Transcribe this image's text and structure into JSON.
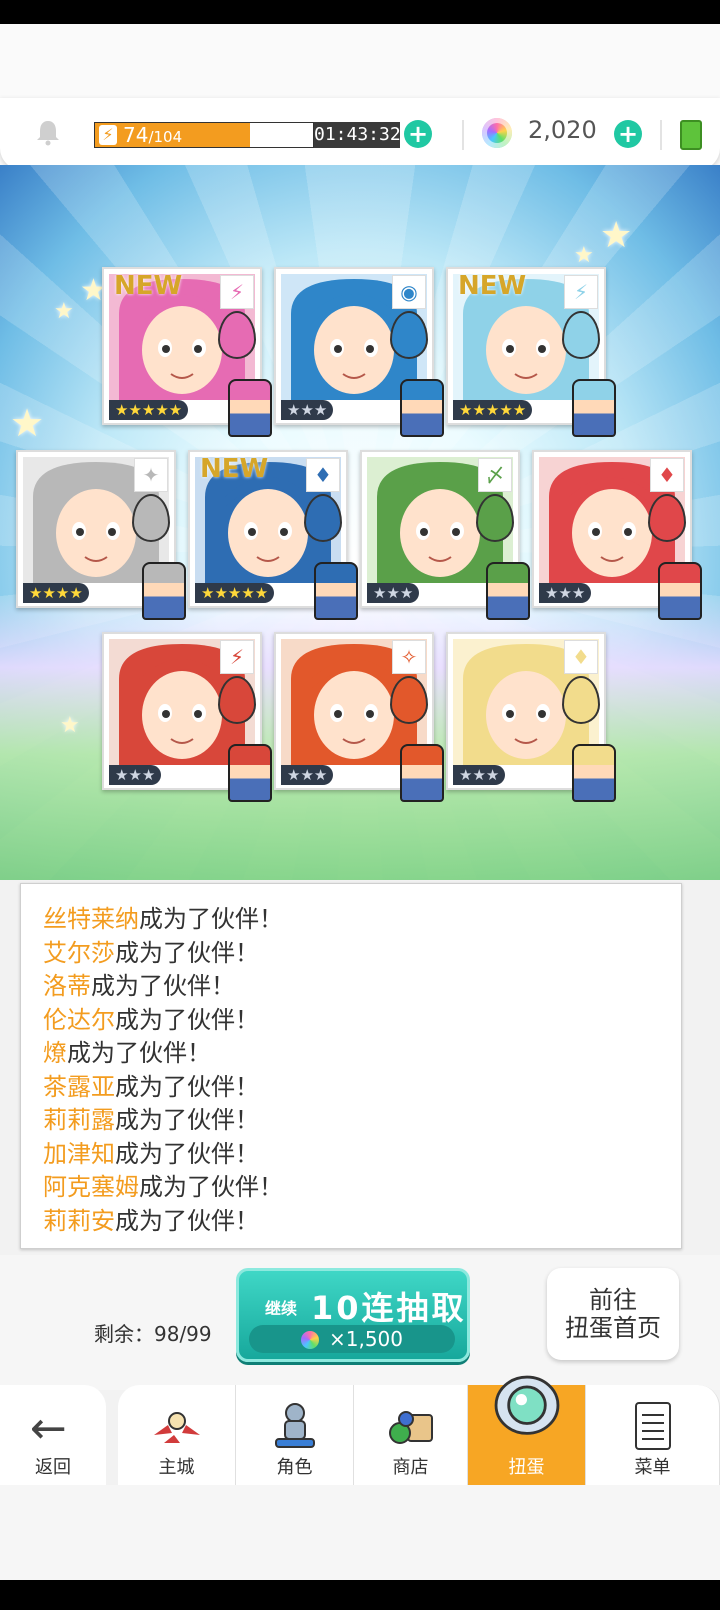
{
  "hud": {
    "stamina_current": "74",
    "stamina_max": "/104",
    "stamina_fraction": 0.71,
    "timer": "01:43:32",
    "gems": "2,020",
    "icons": [
      "bell-icon",
      "bolt-icon",
      "plus-icon",
      "rainbow-gem-icon",
      "battery-icon"
    ]
  },
  "cards": [
    {
      "rarity": "★★★★★",
      "new": "NEW",
      "element": "⚡",
      "element_name": "lightning-icon",
      "portrait_color": "#e66bb3",
      "bg": "#f3b9d3"
    },
    {
      "rarity": "★★★",
      "new": "",
      "element": "◉",
      "element_name": "water-icon",
      "portrait_color": "#2f86c9",
      "bg": "#cfe6f7"
    },
    {
      "rarity": "★★★★★",
      "new": "NEW",
      "element": "⚡",
      "element_name": "lightning-icon",
      "portrait_color": "#8fd2e8",
      "bg": "#e3f4fb"
    },
    {
      "rarity": "★★★★",
      "new": "",
      "element": "✦",
      "element_name": "dark-icon",
      "portrait_color": "#b8b8b8",
      "bg": "#e8e8e8"
    },
    {
      "rarity": "★★★★★",
      "new": "NEW",
      "element": "♦",
      "element_name": "fire-icon",
      "portrait_color": "#2e6db3",
      "bg": "#c9ddf1"
    },
    {
      "rarity": "★★★",
      "new": "",
      "element": "〆",
      "element_name": "wind-icon",
      "portrait_color": "#5aa049",
      "bg": "#dcefd2"
    },
    {
      "rarity": "★★★",
      "new": "",
      "element": "♦",
      "element_name": "fire-icon",
      "portrait_color": "#e0474a",
      "bg": "#f7d3d3"
    },
    {
      "rarity": "★★★",
      "new": "",
      "element": "⚡",
      "element_name": "lightning-icon",
      "portrait_color": "#d8473a",
      "bg": "#f3dbd3"
    },
    {
      "rarity": "★★★",
      "new": "",
      "element": "✧",
      "element_name": "light-icon",
      "portrait_color": "#e2582b",
      "bg": "#f7dac8"
    },
    {
      "rarity": "★★★",
      "new": "",
      "element": "♦",
      "element_name": "fire-icon",
      "portrait_color": "#f2dc8c",
      "bg": "#fbf1cf"
    }
  ],
  "log": {
    "suffix": "成为了伙伴！",
    "names": [
      "丝特莱纳",
      "艾尔莎",
      "洛蒂",
      "伦达尔",
      "燎",
      "茶露亚",
      "莉莉露",
      "加津知",
      "阿克塞姆",
      "莉莉安"
    ]
  },
  "draw": {
    "remaining": "剩余：98/99",
    "continue_label": "继续",
    "main_label": "10连抽取",
    "cost": "×1,500",
    "go_home_line1": "前往",
    "go_home_line2": "扭蛋首页"
  },
  "nav": {
    "back": "返回",
    "items": [
      {
        "label": "主城",
        "icon": "castle-icon"
      },
      {
        "label": "角色",
        "icon": "character-icon"
      },
      {
        "label": "商店",
        "icon": "shop-icon"
      },
      {
        "label": "扭蛋",
        "icon": "gacha-icon",
        "active": true
      },
      {
        "label": "菜单",
        "icon": "menu-icon"
      }
    ]
  }
}
